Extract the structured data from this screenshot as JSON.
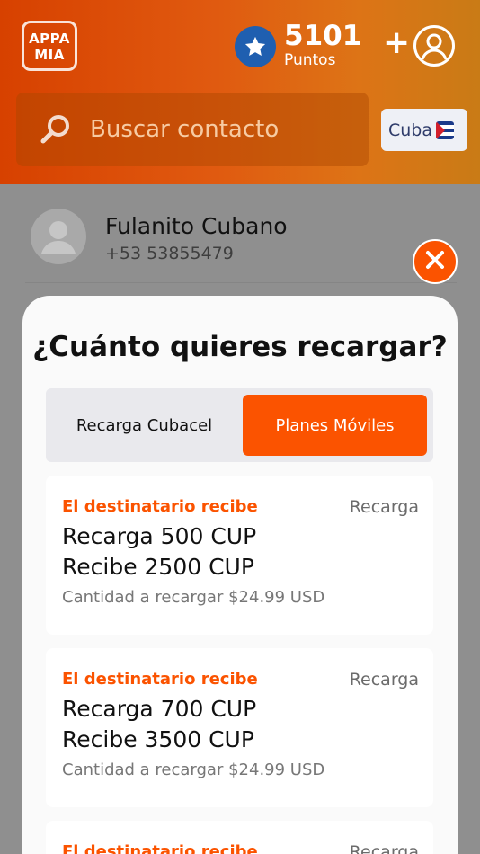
{
  "header": {
    "logo_line1": "APPA",
    "logo_line2": "MIA",
    "points_value": "5101",
    "points_label": "Puntos",
    "plus_label": "+",
    "search_placeholder": "Buscar contacto",
    "country_label": "Cuba"
  },
  "contact": {
    "name": "Fulanito Cubano",
    "phone": "+53 53855479"
  },
  "modal": {
    "title": "¿Cuánto quieres recargar?",
    "tabs": [
      {
        "label": "Recarga Cubacel",
        "selected": false
      },
      {
        "label": "Planes Móviles",
        "selected": true
      }
    ],
    "cards": [
      {
        "tag": "El destinatario recibe",
        "type": "Recarga",
        "line1": "Recarga 500 CUP",
        "line2": "Recibe 2500 CUP",
        "amount": "Cantidad a recargar $24.99 USD"
      },
      {
        "tag": "El destinatario recibe",
        "type": "Recarga",
        "line1": "Recarga 700 CUP",
        "line2": "Recibe 3500 CUP",
        "amount": "Cantidad a recargar $24.99 USD"
      },
      {
        "tag": "El destinatario recibe",
        "type": "Recarga",
        "line1": "",
        "line2": "",
        "amount": ""
      }
    ]
  },
  "colors": {
    "accent": "#fb5300",
    "star_badge": "#1f5fb0"
  }
}
